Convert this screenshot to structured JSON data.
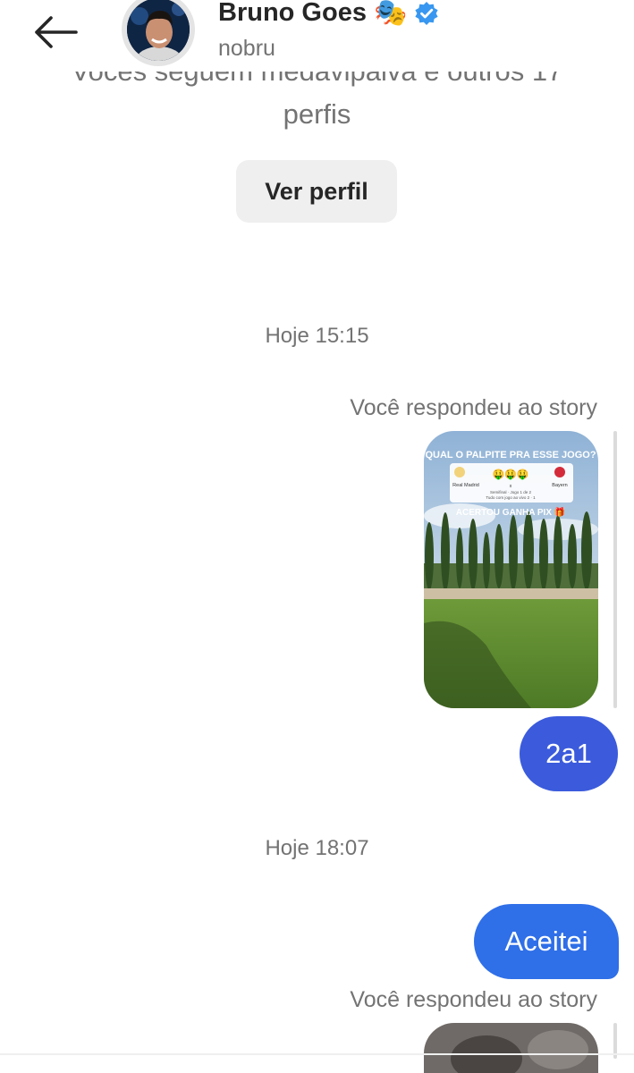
{
  "header": {
    "name": "Bruno Goes",
    "username": "nobru",
    "badge_emoji": "🎭",
    "verified_color": "#3897f0"
  },
  "profile_info": {
    "followers_line1": "Vocês seguem medavipaiva e outros 17",
    "followers_line2": "perfis",
    "view_profile_label": "Ver perfil"
  },
  "messages": [
    {
      "timestamp": "Hoje 15:15",
      "story_reply_label": "Você respondeu ao story",
      "story": {
        "title": "QUAL O PALPITE PRA ESSE JOGO?",
        "team_home": "Real Madrid",
        "team_away": "Bayern",
        "emojis": "🤑🤑🤑",
        "vs": "x",
        "subtitle": "Semifinal · Jogo 1 de 2",
        "subtitle2": "Tudo com jogo ao vivo 2 · 1",
        "prize_text": "ACERTOU GANHA PIX 🎁"
      },
      "reply_text": "2a1"
    },
    {
      "timestamp": "Hoje 18:07",
      "reply_text": "Aceitei",
      "story_reply_label": "Você respondeu ao story"
    }
  ],
  "colors": {
    "bubble_1": "#3b5bdc",
    "bubble_2": "#2f6fe8",
    "muted_text": "#737373",
    "button_bg": "#efefef"
  }
}
